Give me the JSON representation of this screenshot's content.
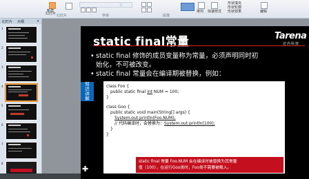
{
  "ribbon": {
    "new_slide_label": "新建",
    "new_slide_sub": "幻灯片",
    "group_slides": "幻灯片",
    "group_font": "字体",
    "group_paragraph": "段落",
    "arrange_label": "排列",
    "quick_styles_label": "快速样式",
    "shape_fill": "形状填充",
    "shape_outline": "形状轮廓",
    "shape_effects": "形状效果",
    "edit_label": "编辑"
  },
  "sidebar": {
    "tab_slides": "幻灯片",
    "tab_outline": "大纲",
    "thumbnail_numbers": [
      "1",
      "2",
      "3",
      "4",
      "5",
      "6",
      "7",
      "8"
    ]
  },
  "slide": {
    "title": "static  final常量",
    "logo_word": "Tarena",
    "logo_sub": "达内科技",
    "bullets": [
      {
        "pre": "static final ",
        "em": "修饰的成员变量称为常量，必须声明同时初",
        "post": ""
      },
      {
        "pre": "",
        "em": "始化，不可被改变。",
        "post": ""
      },
      {
        "pre": "static final ",
        "em": "常量会在编译期被替换，例如：",
        "post": ""
      }
    ],
    "side_tag": "知识讲解",
    "code": {
      "line1": "class Foo {",
      "line2a": "public static final ",
      "line2b": "int",
      "line2c": " NUM = 100;",
      "line3": "}",
      "line4": "class Goo {",
      "line5": "public static void main(String[] args) {",
      "line6": "System.out.println(Foo.NUM);",
      "line7a": "// 代码编译时，会替换为：",
      "line7b": "System.out.println(100);",
      "line8": "}",
      "line9": "}"
    },
    "note_line1": "static final 常量 Foo.NUM 会在编译时被替换为其常量",
    "note_line2": "值（100），在运行Goo类时，Foo类不需要被载入。"
  },
  "colors": {
    "title_rule": "#e31b23",
    "accent_blue": "#0c66b8",
    "note_red": "#c4101e"
  }
}
